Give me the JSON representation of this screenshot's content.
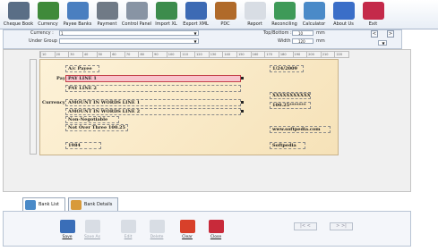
{
  "toolbar": {
    "items": [
      {
        "label": "Cheque Book",
        "icon": "cheque-book-icon",
        "color": "#5a6e86"
      },
      {
        "label": "Currency",
        "icon": "currency-icon",
        "color": "#3f8a3a"
      },
      {
        "label": "Payee Banks",
        "icon": "payee-banks-icon",
        "color": "#4a7fc0"
      },
      {
        "label": "Payment",
        "icon": "payment-icon",
        "color": "#707a86"
      },
      {
        "label": "Control Panel",
        "icon": "control-panel-icon",
        "color": "#8894a4"
      },
      {
        "label": "Import XL",
        "icon": "import-excel-icon",
        "color": "#3c8c4c"
      },
      {
        "label": "Export XML",
        "icon": "export-xml-icon",
        "color": "#3c6ab4"
      },
      {
        "label": "PDC",
        "icon": "pdc-icon",
        "color": "#b06a2a"
      },
      {
        "label": "Report",
        "icon": "report-icon",
        "color": "#d8dde4"
      },
      {
        "label": "Reconciling",
        "icon": "reconciling-icon",
        "color": "#3e9a58"
      },
      {
        "label": "Calculator",
        "icon": "calculator-icon",
        "color": "#4a8ac8"
      },
      {
        "label": "About Us",
        "icon": "about-us-icon",
        "color": "#3a6ec8"
      },
      {
        "label": "Exit",
        "icon": "exit-icon",
        "color": "#c42a4a"
      }
    ]
  },
  "filter": {
    "currency_label": "Currency :",
    "currency_value": "1",
    "under_group_label": "Under Group :",
    "top_bottom_label": "Top/Bottom :",
    "top_bottom_value": "10",
    "top_bottom_unit": "mm",
    "width_label": "Width :",
    "width_value": "120",
    "width_unit": "mm",
    "prev_label": "<",
    "next_label": ">"
  },
  "ruler": [
    "10",
    "20",
    "30",
    "40",
    "50",
    "60",
    "70",
    "80",
    "90",
    "100",
    "110",
    "120",
    "130",
    "140",
    "150",
    "160",
    "170",
    "180",
    "190",
    "200",
    "210",
    "220"
  ],
  "cheque": {
    "ac_payee": "A/c Payee",
    "date": "1/24/2009",
    "pay_label": "Pay",
    "pay_line1": "PAY LINE 1",
    "pay_line2": "PAY LINE 2",
    "currency_label": "Currency",
    "amount_line1": "AMOUNT IN WORDS LINE 1",
    "amount_line2": "AMOUNT IN WORDS LINE 2",
    "account_x": "XXXXXXXXXXX",
    "amount_figures": "100.25*******",
    "non_negotiable": "Non-Negotiable",
    "not_over": "Not Over Three 100.25",
    "website": "www.softpedia.com",
    "cheque_no": "1984",
    "signatory": "Softpedia"
  },
  "tabs": {
    "bank_list": "Bank List",
    "bank_details": "Bank Details"
  },
  "actions": {
    "save": "Save",
    "save_as": "Save As",
    "edit": "Edit",
    "delete": "Delete",
    "clear": "Clear",
    "close": "Close"
  },
  "pager": {
    "first_prev": "|< <",
    "next_last": "> >|"
  }
}
